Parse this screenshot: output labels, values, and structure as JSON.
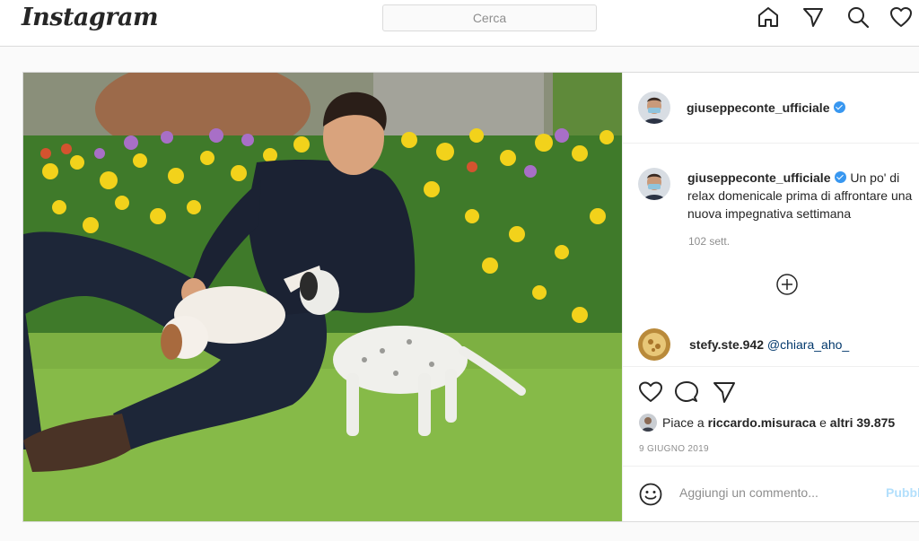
{
  "nav": {
    "logo": "Instagram",
    "search_placeholder": "Cerca",
    "icons": [
      "home-icon",
      "direct-icon",
      "explore-icon",
      "activity-icon"
    ]
  },
  "post": {
    "author": {
      "username": "giuseppeconte_ufficiale",
      "verified": true
    },
    "caption": {
      "username": "giuseppeconte_ufficiale",
      "text": "Un po' di relax domenicale prima di affrontare una nuova impegnativa settimana",
      "time_ago": "102 sett."
    },
    "load_more_icon": "plus-circle-icon",
    "comments": [
      {
        "username": "stefy.ste.942",
        "text": "@chiara_aho_"
      }
    ],
    "actions": [
      "like-icon",
      "comment-icon",
      "share-icon"
    ],
    "likes": {
      "prefix": "Piace a ",
      "user": "riccardo.misuraca",
      "middle": " e ",
      "others": "altri 39.875"
    },
    "date": "9 GIUGNO 2019",
    "add_comment": {
      "placeholder": "Aggiungi un commento...",
      "publish": "Pubblica"
    },
    "colors": {
      "link": "#00376b",
      "verified": "#3897f0",
      "publish_disabled": "#b2dffc",
      "muted": "#8e8e8e"
    }
  }
}
